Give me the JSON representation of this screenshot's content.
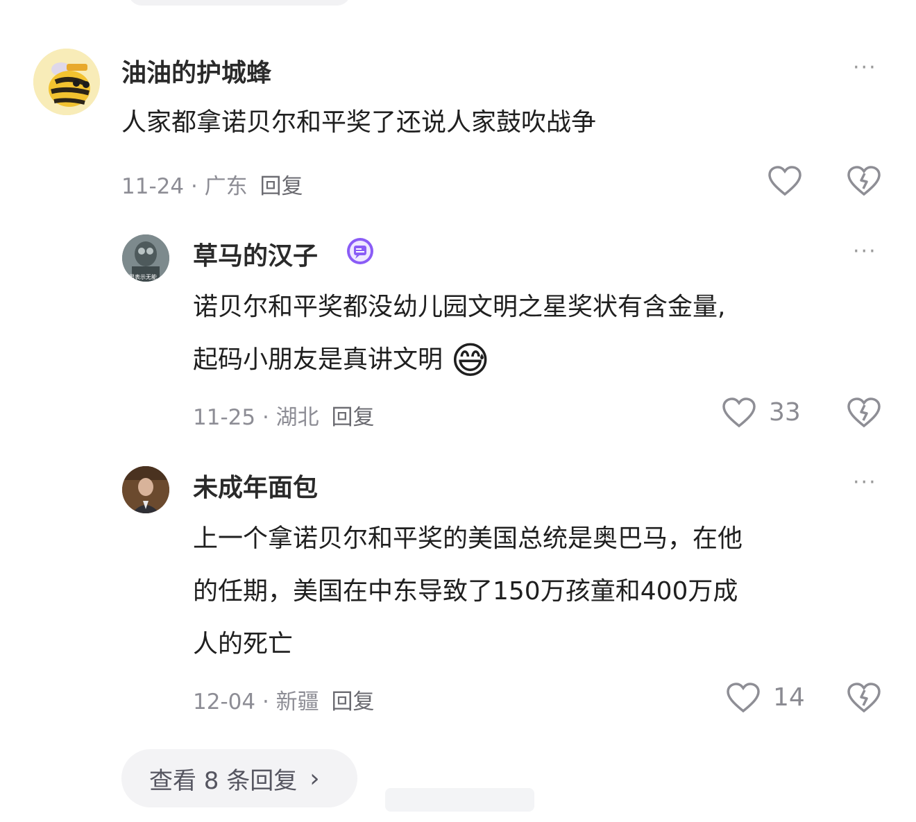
{
  "comments": [
    {
      "username": "油油的护城蜂",
      "text_lines": [
        "人家都拿诺贝尔和平奖了还说人家鼓吹战争"
      ],
      "date": "11-24",
      "location": "广东",
      "reply_label": "回复",
      "like_count": ""
    },
    {
      "username": "草马的汉子",
      "badge": "chat-badge-icon",
      "avatar_caption": "男表示无能",
      "text_lines": [
        "诺贝尔和平奖都没幼儿园文明之星奖状有含金量,",
        "起码小朋友是真讲文明"
      ],
      "emoji": "😅",
      "date": "11-25",
      "location": "湖北",
      "reply_label": "回复",
      "like_count": "33"
    },
    {
      "username": "未成年面包",
      "text_lines": [
        "上一个拿诺贝尔和平奖的美国总统是奥巴马，在他",
        "的任期，美国在中东导致了150万孩童和400万成",
        "人的死亡"
      ],
      "date": "12-04",
      "location": "新疆",
      "reply_label": "回复",
      "like_count": "14"
    }
  ],
  "more_label": "···",
  "separator": "·",
  "view_replies_label": "查看 8 条回复",
  "view_replies_chevron": "›",
  "colors": {
    "accent_badge": "#8a5cf6",
    "meta": "#8d8d95"
  }
}
